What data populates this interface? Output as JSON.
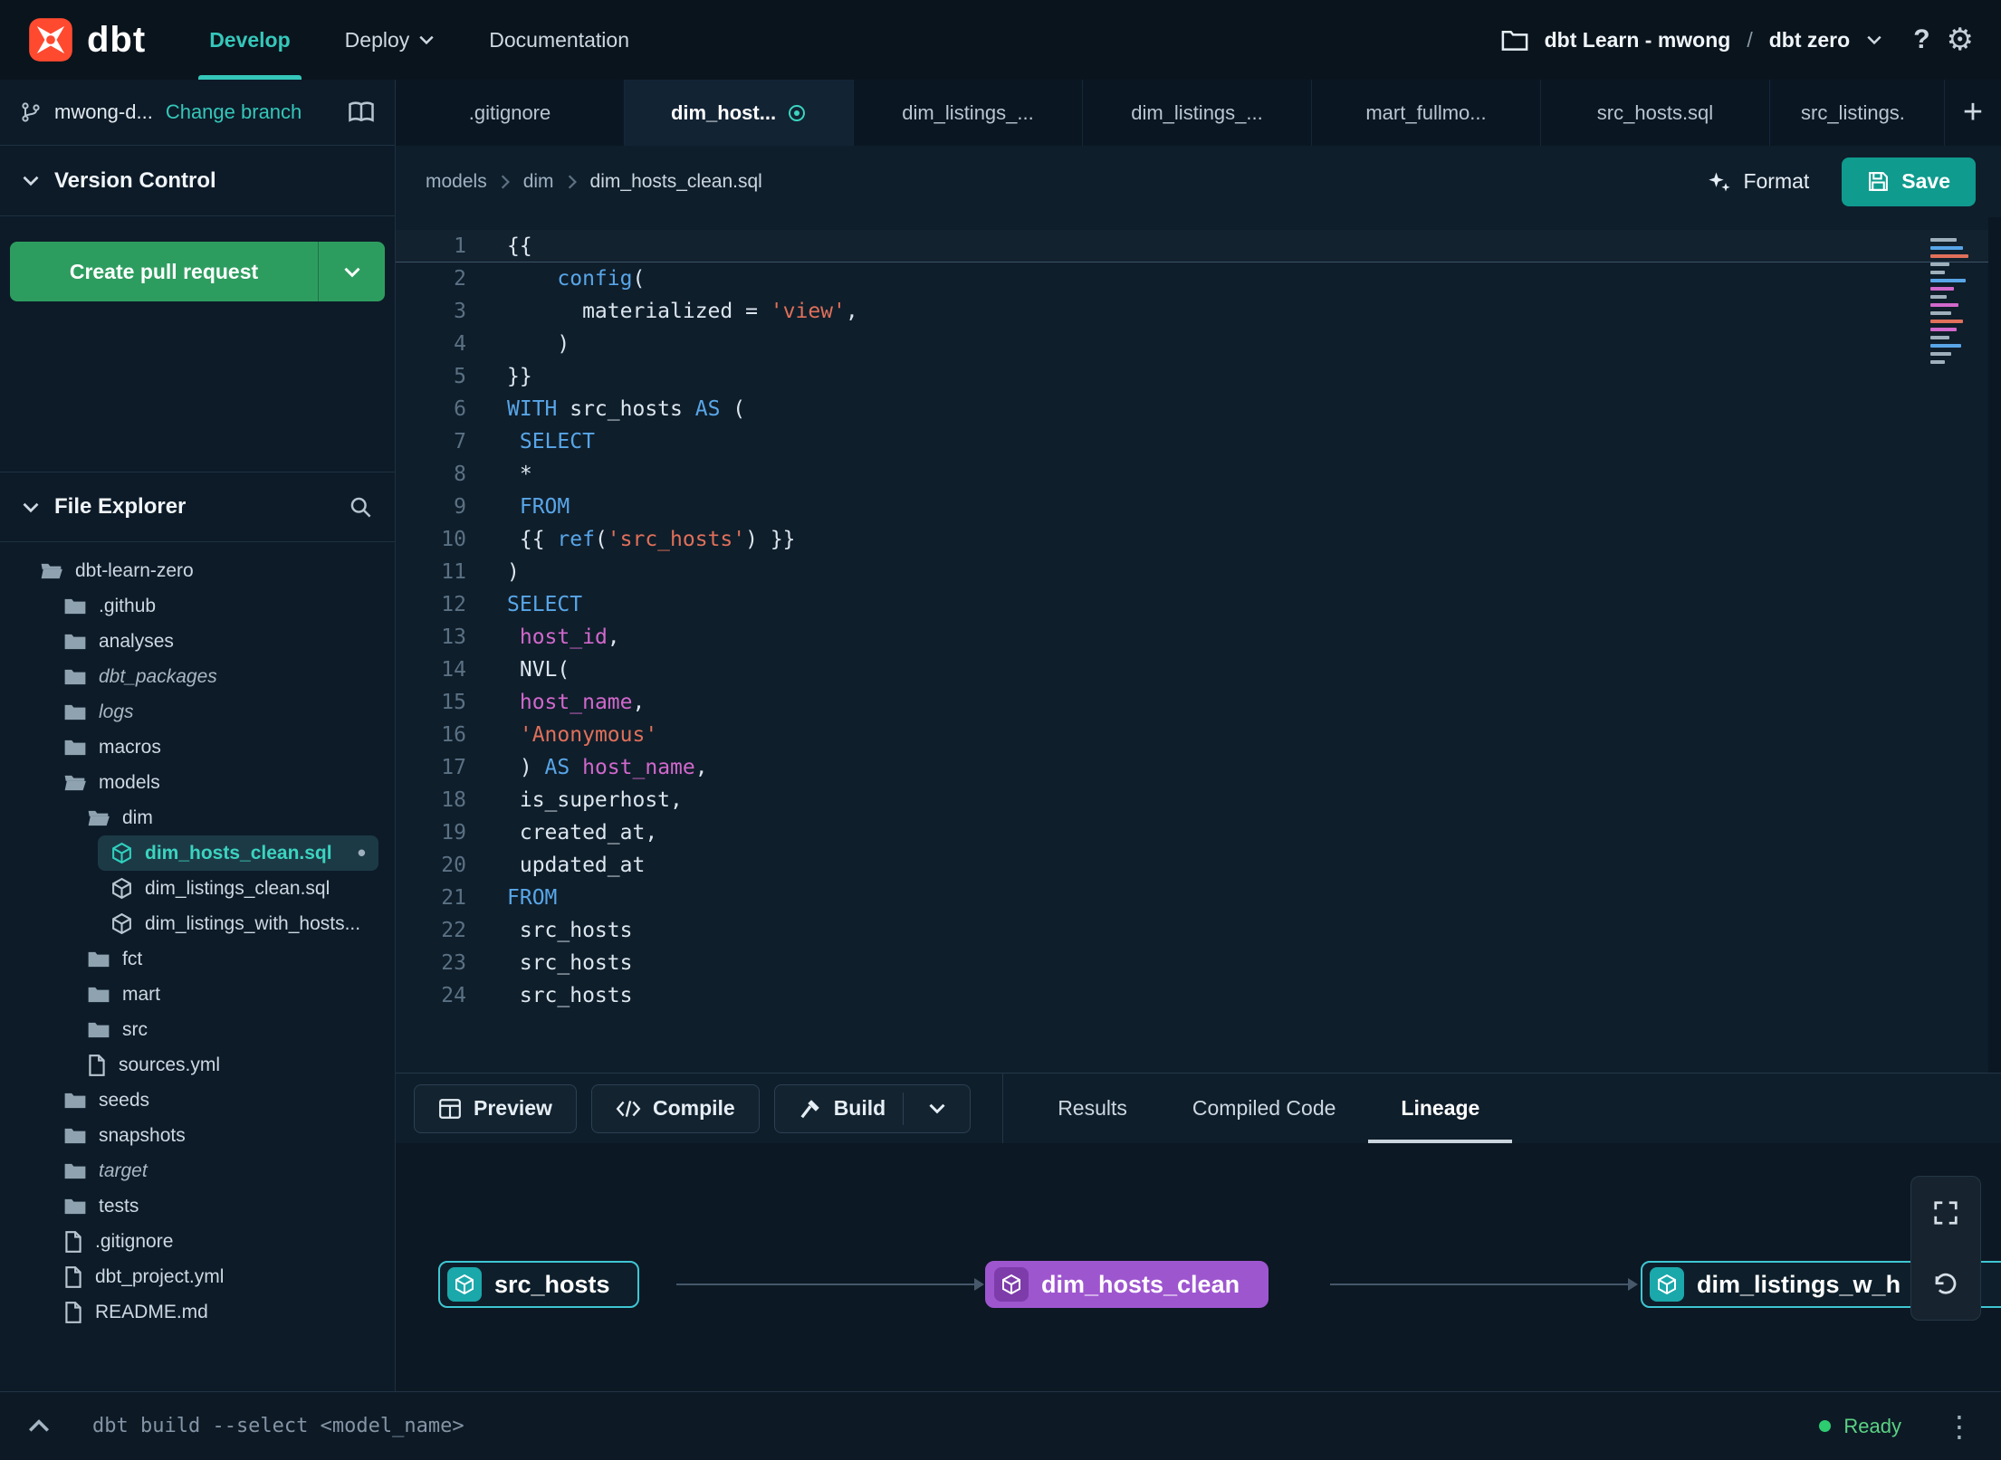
{
  "colors": {
    "accent_teal": "#35c7ba",
    "brand_orange": "#ff4a2f",
    "pr_green": "#2d9d5f",
    "save_teal": "#0f9b8e",
    "node_purple": "#9e56cf",
    "node_teal_border": "#3fc6d3",
    "status_green": "#2ecc71"
  },
  "icons": {
    "plus": "+",
    "help": "?",
    "gear": "⚙",
    "kebab": "⋮",
    "modified_dot": "•"
  },
  "topbar": {
    "logo_text": "dbt",
    "nav": [
      {
        "label": "Develop",
        "active": true
      },
      {
        "label": "Deploy",
        "caret": true
      },
      {
        "label": "Documentation"
      }
    ],
    "project": "dbt Learn - mwong",
    "path_separator": "/",
    "environment": "dbt zero"
  },
  "sidebar": {
    "branch_name": "mwong-d...",
    "change_branch_label": "Change branch",
    "version_control_label": "Version Control",
    "create_pr_label": "Create pull request",
    "file_explorer_label": "File Explorer",
    "tree": [
      {
        "label": "dbt-learn-zero",
        "type": "folder",
        "depth": 0,
        "open": true
      },
      {
        "label": ".github",
        "type": "folder",
        "depth": 1
      },
      {
        "label": "analyses",
        "type": "folder",
        "depth": 1
      },
      {
        "label": "dbt_packages",
        "type": "folder",
        "depth": 1,
        "italic": true
      },
      {
        "label": "logs",
        "type": "folder",
        "depth": 1,
        "italic": true
      },
      {
        "label": "macros",
        "type": "folder",
        "depth": 1
      },
      {
        "label": "models",
        "type": "folder",
        "depth": 1,
        "open": true
      },
      {
        "label": "dim",
        "type": "folder",
        "depth": 2,
        "open": true
      },
      {
        "label": "dim_hosts_clean.sql",
        "type": "model",
        "depth": 3,
        "selected": true,
        "modified": true
      },
      {
        "label": "dim_listings_clean.sql",
        "type": "model",
        "depth": 3
      },
      {
        "label": "dim_listings_with_hosts...",
        "type": "model",
        "depth": 3
      },
      {
        "label": "fct",
        "type": "folder",
        "depth": 2
      },
      {
        "label": "mart",
        "type": "folder",
        "depth": 2
      },
      {
        "label": "src",
        "type": "folder",
        "depth": 2
      },
      {
        "label": "sources.yml",
        "type": "file",
        "depth": 2
      },
      {
        "label": "seeds",
        "type": "folder",
        "depth": 1
      },
      {
        "label": "snapshots",
        "type": "folder",
        "depth": 1
      },
      {
        "label": "target",
        "type": "folder",
        "depth": 1,
        "italic": true
      },
      {
        "label": "tests",
        "type": "folder",
        "depth": 1
      },
      {
        "label": ".gitignore",
        "type": "file",
        "depth": 1
      },
      {
        "label": "dbt_project.yml",
        "type": "file",
        "depth": 1
      },
      {
        "label": "README.md",
        "type": "file",
        "depth": 1
      }
    ]
  },
  "editor_tabs": [
    {
      "label": ".gitignore"
    },
    {
      "label": "dim_host...",
      "active": true
    },
    {
      "label": "dim_listings_..."
    },
    {
      "label": "dim_listings_..."
    },
    {
      "label": "mart_fullmo..."
    },
    {
      "label": "src_hosts.sql"
    },
    {
      "label": "src_listings."
    }
  ],
  "breadcrumb": {
    "items": [
      "models",
      "dim",
      "dim_hosts_clean.sql"
    ]
  },
  "editor_actions": {
    "format_label": "Format",
    "save_label": "Save"
  },
  "code": {
    "lines": [
      [
        [
          "{{",
          "pl"
        ]
      ],
      [
        [
          "    ",
          "pl"
        ],
        [
          "config",
          "kw"
        ],
        [
          "(",
          "pl"
        ]
      ],
      [
        [
          "      materialized = ",
          "pl"
        ],
        [
          "'view'",
          "str"
        ],
        [
          ",",
          "pl"
        ]
      ],
      [
        [
          "    )",
          "pl"
        ]
      ],
      [
        [
          "}}",
          "pl"
        ]
      ],
      [
        [
          "WITH",
          "kw"
        ],
        [
          " src_hosts ",
          "pl"
        ],
        [
          "AS",
          "kw"
        ],
        [
          " (",
          "pl"
        ]
      ],
      [
        [
          " ",
          "pl"
        ],
        [
          "SELECT",
          "kw"
        ]
      ],
      [
        [
          " *",
          "pl"
        ]
      ],
      [
        [
          " ",
          "pl"
        ],
        [
          "FROM",
          "kw"
        ]
      ],
      [
        [
          " {{ ",
          "pl"
        ],
        [
          "ref",
          "kw"
        ],
        [
          "(",
          "pl"
        ],
        [
          "'src_hosts'",
          "str"
        ],
        [
          ")",
          "pl"
        ],
        [
          " }}",
          "pl"
        ]
      ],
      [
        [
          ")",
          "pl"
        ]
      ],
      [
        [
          "SELECT",
          "kw"
        ]
      ],
      [
        [
          " ",
          "pl"
        ],
        [
          "host_id",
          "id"
        ],
        [
          ",",
          "pl"
        ]
      ],
      [
        [
          " NVL(",
          "pl"
        ]
      ],
      [
        [
          " ",
          "pl"
        ],
        [
          "host_name",
          "id"
        ],
        [
          ",",
          "pl"
        ]
      ],
      [
        [
          " ",
          "pl"
        ],
        [
          "'Anonymous'",
          "str"
        ]
      ],
      [
        [
          " ) ",
          "pl"
        ],
        [
          "AS",
          "kw"
        ],
        [
          " ",
          "pl"
        ],
        [
          "host_name",
          "id"
        ],
        [
          ",",
          "pl"
        ]
      ],
      [
        [
          " is_superhost,",
          "pl"
        ]
      ],
      [
        [
          " created_at,",
          "pl"
        ]
      ],
      [
        [
          " updated_at",
          "pl"
        ]
      ],
      [
        [
          "FROM",
          "kw"
        ]
      ],
      [
        [
          " src_hosts",
          "pl"
        ]
      ],
      [
        [
          " src_hosts",
          "pl"
        ]
      ],
      [
        [
          " src_hosts",
          "pl"
        ]
      ]
    ]
  },
  "bottom_panel": {
    "buttons": {
      "preview": "Preview",
      "compile": "Compile",
      "build": "Build"
    },
    "tabs": [
      {
        "label": "Results"
      },
      {
        "label": "Compiled Code"
      },
      {
        "label": "Lineage",
        "active": true
      }
    ]
  },
  "lineage": {
    "nodes": [
      {
        "label": "src_hosts",
        "variant": "teal"
      },
      {
        "label": "dim_hosts_clean",
        "variant": "purple"
      },
      {
        "label": "dim_listings_w_h",
        "variant": "teal"
      }
    ]
  },
  "command_bar": {
    "command": "dbt build --select <model_name>",
    "status": "Ready"
  }
}
